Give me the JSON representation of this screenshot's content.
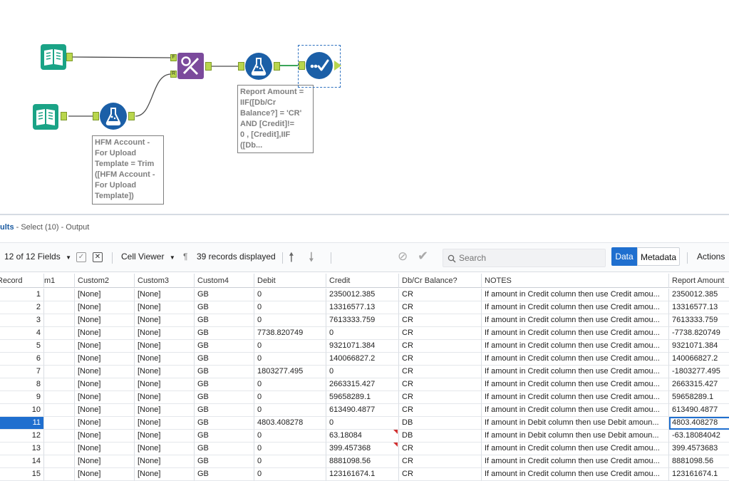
{
  "canvas": {
    "annotations": {
      "formula_left": "HFM Account -\nFor Upload\nTemplate = Trim\n([HFM Account -\nFor Upload\nTemplate])",
      "formula_right": "Report Amount =\nIIF([Db/Cr\nBalance?] = 'CR'\nAND [Credit]!=\n0  , [Credit],IIF\n([Db..."
    },
    "join_anchor_top": "F",
    "join_anchor_bottom": "R",
    "icons": {
      "input_top": "input-data-book-icon",
      "input_bottom": "input-data-book-icon",
      "formula_left": "formula-flask-icon",
      "join": "join-icon",
      "formula_right": "formula-flask-icon",
      "select": "select-check-icon"
    },
    "colors": {
      "input_tool": "#1aa386",
      "formula_tool": "#1b5fa7",
      "join_tool": "#7b4a9c",
      "select_tool": "#1b5fa7",
      "anchor": "#b9d64d"
    }
  },
  "results": {
    "title_prefix": "ults",
    "title_suffix": " - Select (10) - Output",
    "toolbar": {
      "fields_label": "12 of 12 Fields",
      "cell_viewer_label": "Cell Viewer",
      "records_label": "39 records displayed",
      "search_placeholder": "Search",
      "data_label": "Data",
      "metadata_label": "Metadata",
      "actions_label": "Actions"
    },
    "columns": [
      "Record",
      "m1",
      "Custom2",
      "Custom3",
      "Custom4",
      "Debit",
      "Credit",
      "Db/Cr Balance?",
      "NOTES",
      "Report Amount"
    ],
    "rows": [
      {
        "record": "1",
        "custom2": "[None]",
        "custom3": "[None]",
        "custom4": "GB",
        "debit": "0",
        "credit": "2350012.385",
        "dbcr": "CR",
        "notes": "If amount in Credit column then use Credit amou...",
        "report": "2350012.385"
      },
      {
        "record": "2",
        "custom2": "[None]",
        "custom3": "[None]",
        "custom4": "GB",
        "debit": "0",
        "credit": "13316577.13",
        "dbcr": "CR",
        "notes": "If amount in Credit column then use Credit amou...",
        "report": "13316577.13"
      },
      {
        "record": "3",
        "custom2": "[None]",
        "custom3": "[None]",
        "custom4": "GB",
        "debit": "0",
        "credit": "7613333.759",
        "dbcr": "CR",
        "notes": "If amount in Credit column then use Credit amou...",
        "report": "7613333.759"
      },
      {
        "record": "4",
        "custom2": "[None]",
        "custom3": "[None]",
        "custom4": "GB",
        "debit": "7738.820749",
        "credit": "0",
        "dbcr": "CR",
        "notes": "If amount in Credit column then use Credit amou...",
        "report": "-7738.820749"
      },
      {
        "record": "5",
        "custom2": "[None]",
        "custom3": "[None]",
        "custom4": "GB",
        "debit": "0",
        "credit": "9321071.384",
        "dbcr": "CR",
        "notes": "If amount in Credit column then use Credit amou...",
        "report": "9321071.384"
      },
      {
        "record": "6",
        "custom2": "[None]",
        "custom3": "[None]",
        "custom4": "GB",
        "debit": "0",
        "credit": "140066827.2",
        "dbcr": "CR",
        "notes": "If amount in Credit column then use Credit amou...",
        "report": "140066827.2"
      },
      {
        "record": "7",
        "custom2": "[None]",
        "custom3": "[None]",
        "custom4": "GB",
        "debit": "1803277.495",
        "credit": "0",
        "dbcr": "CR",
        "notes": "If amount in Credit column then use Credit amou...",
        "report": "-1803277.495"
      },
      {
        "record": "8",
        "custom2": "[None]",
        "custom3": "[None]",
        "custom4": "GB",
        "debit": "0",
        "credit": "2663315.427",
        "dbcr": "CR",
        "notes": "If amount in Credit column then use Credit amou...",
        "report": "2663315.427"
      },
      {
        "record": "9",
        "custom2": "[None]",
        "custom3": "[None]",
        "custom4": "GB",
        "debit": "0",
        "credit": "59658289.1",
        "dbcr": "CR",
        "notes": "If amount in Credit column then use Credit amou...",
        "report": "59658289.1"
      },
      {
        "record": "10",
        "custom2": "[None]",
        "custom3": "[None]",
        "custom4": "GB",
        "debit": "0",
        "credit": "613490.4877",
        "dbcr": "CR",
        "notes": "If amount in Credit column then use Credit amou...",
        "report": "613490.4877"
      },
      {
        "record": "11",
        "custom2": "[None]",
        "custom3": "[None]",
        "custom4": "GB",
        "debit": "4803.408278",
        "credit": "0",
        "dbcr": "DB",
        "notes": "If amount in Debit column then use Debit amoun...",
        "report": "4803.408278"
      },
      {
        "record": "12",
        "custom2": "[None]",
        "custom3": "[None]",
        "custom4": "GB",
        "debit": "0",
        "credit": "63.18084",
        "dbcr": "DB",
        "notes": "If amount in Debit column then use Debit amoun...",
        "report": "-63.18084042"
      },
      {
        "record": "13",
        "custom2": "[None]",
        "custom3": "[None]",
        "custom4": "GB",
        "debit": "0",
        "credit": "399.457368",
        "dbcr": "CR",
        "notes": "If amount in Credit column then use Credit amou...",
        "report": "399.4573683"
      },
      {
        "record": "14",
        "custom2": "[None]",
        "custom3": "[None]",
        "custom4": "GB",
        "debit": "0",
        "credit": "8881098.56",
        "dbcr": "CR",
        "notes": "If amount in Credit column then use Credit amou...",
        "report": "8881098.56"
      },
      {
        "record": "15",
        "custom2": "[None]",
        "custom3": "[None]",
        "custom4": "GB",
        "debit": "0",
        "credit": "123161674.1",
        "dbcr": "CR",
        "notes": "If amount in Credit column then use Credit amou...",
        "report": "123161674.1"
      }
    ],
    "selected_record": "11",
    "flagged_credit_rows": [
      "12",
      "13"
    ]
  }
}
